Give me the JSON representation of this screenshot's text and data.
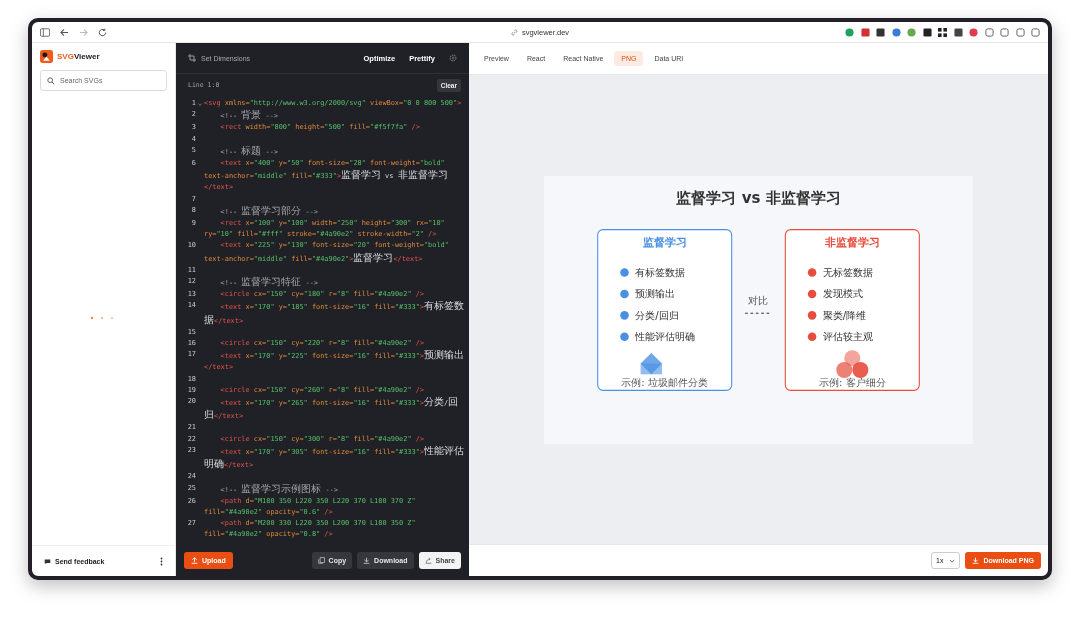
{
  "browser": {
    "url": "svgviewer.dev",
    "forward_disabled": true
  },
  "sidebar": {
    "logo_accent": "SVG",
    "logo_rest": "Viewer",
    "search": {
      "placeholder": "Search SVGs"
    },
    "feedback": "Send feedback"
  },
  "editor": {
    "dimensions": "Set Dimensions",
    "actions": [
      "Optimize",
      "Prettify"
    ],
    "status": "Line 1:0",
    "clear": "Clear",
    "lines": [
      {
        "no": "1",
        "foldable": true,
        "tokens": [
          {
            "kind": "tag",
            "text": "<svg"
          },
          {
            "kind": "attr",
            "text": " xmlns="
          },
          {
            "kind": "val",
            "text": "\"http://www.w3.org/2000/svg\""
          },
          {
            "kind": "attr",
            "text": " viewBox="
          },
          {
            "kind": "val",
            "text": "\"0 0 800 500\""
          },
          {
            "kind": "tag",
            "text": ">"
          }
        ]
      },
      {
        "no": "2",
        "foldable": false,
        "tokens": [
          {
            "kind": "comment",
            "text": "    <!-- 背景 -->"
          }
        ]
      },
      {
        "no": "3",
        "foldable": false,
        "tokens": [
          {
            "kind": "tag",
            "text": "    <rect"
          },
          {
            "kind": "attr",
            "text": " width="
          },
          {
            "kind": "val",
            "text": "\"800\""
          },
          {
            "kind": "attr",
            "text": " height="
          },
          {
            "kind": "val",
            "text": "\"500\""
          },
          {
            "kind": "attr",
            "text": " fill="
          },
          {
            "kind": "val",
            "text": "\"#f5f7fa\""
          },
          {
            "kind": "tag",
            "text": " />"
          }
        ]
      },
      {
        "no": "4",
        "foldable": false
      },
      {
        "no": "5",
        "foldable": false,
        "tokens": [
          {
            "kind": "comment",
            "text": "    <!-- 标题 -->"
          }
        ]
      },
      {
        "no": "6",
        "foldable": false,
        "tokens": [
          {
            "kind": "tag",
            "text": "    <text"
          },
          {
            "kind": "attr",
            "text": " x="
          },
          {
            "kind": "val",
            "text": "\"400\""
          },
          {
            "kind": "attr",
            "text": " y="
          },
          {
            "kind": "val",
            "text": "\"50\""
          },
          {
            "kind": "attr",
            "text": " font-size="
          },
          {
            "kind": "val",
            "text": "\"28\""
          },
          {
            "kind": "attr",
            "text": " font-weight="
          },
          {
            "kind": "val",
            "text": "\"bold\""
          },
          {
            "kind": "attr",
            "text": " text-anchor="
          },
          {
            "kind": "val",
            "text": "\"middle\""
          },
          {
            "kind": "attr",
            "text": " fill="
          },
          {
            "kind": "val",
            "text": "\"#333\""
          },
          {
            "kind": "tag",
            "text": ">"
          },
          {
            "kind": "text",
            "text": "监督学习 vs 非监督学习"
          },
          {
            "kind": "tag",
            "text": "</text>"
          }
        ]
      },
      {
        "no": "7",
        "foldable": false
      },
      {
        "no": "8",
        "foldable": false,
        "tokens": [
          {
            "kind": "comment",
            "text": "    <!-- 监督学习部分 -->"
          }
        ]
      },
      {
        "no": "9",
        "foldable": false,
        "tokens": [
          {
            "kind": "tag",
            "text": "    <rect"
          },
          {
            "kind": "attr",
            "text": " x="
          },
          {
            "kind": "val",
            "text": "\"100\""
          },
          {
            "kind": "attr",
            "text": " y="
          },
          {
            "kind": "val",
            "text": "\"100\""
          },
          {
            "kind": "attr",
            "text": " width="
          },
          {
            "kind": "val",
            "text": "\"250\""
          },
          {
            "kind": "attr",
            "text": " height="
          },
          {
            "kind": "val",
            "text": "\"300\""
          },
          {
            "kind": "attr",
            "text": " rx="
          },
          {
            "kind": "val",
            "text": "\"10\""
          },
          {
            "kind": "attr",
            "text": " ry="
          },
          {
            "kind": "val",
            "text": "\"10\""
          },
          {
            "kind": "attr",
            "text": " fill="
          },
          {
            "kind": "val",
            "text": "\"#fff\""
          },
          {
            "kind": "attr",
            "text": " stroke="
          },
          {
            "kind": "val",
            "text": "\"#4a90e2\""
          },
          {
            "kind": "attr",
            "text": " stroke-width="
          },
          {
            "kind": "val",
            "text": "\"2\""
          },
          {
            "kind": "tag",
            "text": " />"
          }
        ]
      },
      {
        "no": "10",
        "foldable": false,
        "tokens": [
          {
            "kind": "tag",
            "text": "    <text"
          },
          {
            "kind": "attr",
            "text": " x="
          },
          {
            "kind": "val",
            "text": "\"225\""
          },
          {
            "kind": "attr",
            "text": " y="
          },
          {
            "kind": "val",
            "text": "\"130\""
          },
          {
            "kind": "attr",
            "text": " font-size="
          },
          {
            "kind": "val",
            "text": "\"20\""
          },
          {
            "kind": "attr",
            "text": " font-weight="
          },
          {
            "kind": "val",
            "text": "\"bold\""
          },
          {
            "kind": "attr",
            "text": " text-anchor="
          },
          {
            "kind": "val",
            "text": "\"middle\""
          },
          {
            "kind": "attr",
            "text": " fill="
          },
          {
            "kind": "val",
            "text": "\"#4a90e2\""
          },
          {
            "kind": "tag",
            "text": ">"
          },
          {
            "kind": "text",
            "text": "监督学习"
          },
          {
            "kind": "tag",
            "text": "</text>"
          }
        ]
      },
      {
        "no": "11",
        "foldable": false
      },
      {
        "no": "12",
        "foldable": false,
        "tokens": [
          {
            "kind": "comment",
            "text": "    <!-- 监督学习特征 -->"
          }
        ]
      },
      {
        "no": "13",
        "foldable": false,
        "tokens": [
          {
            "kind": "tag",
            "text": "    <circle"
          },
          {
            "kind": "attr",
            "text": " cx="
          },
          {
            "kind": "val",
            "text": "\"150\""
          },
          {
            "kind": "attr",
            "text": " cy="
          },
          {
            "kind": "val",
            "text": "\"180\""
          },
          {
            "kind": "attr",
            "text": " r="
          },
          {
            "kind": "val",
            "text": "\"8\""
          },
          {
            "kind": "attr",
            "text": " fill="
          },
          {
            "kind": "val",
            "text": "\"#4a90e2\""
          },
          {
            "kind": "tag",
            "text": " />"
          }
        ]
      },
      {
        "no": "14",
        "foldable": false,
        "tokens": [
          {
            "kind": "tag",
            "text": "    <text"
          },
          {
            "kind": "attr",
            "text": " x="
          },
          {
            "kind": "val",
            "text": "\"170\""
          },
          {
            "kind": "attr",
            "text": " y="
          },
          {
            "kind": "val",
            "text": "\"185\""
          },
          {
            "kind": "attr",
            "text": " font-size="
          },
          {
            "kind": "val",
            "text": "\"16\""
          },
          {
            "kind": "attr",
            "text": " fill="
          },
          {
            "kind": "val",
            "text": "\"#333\""
          },
          {
            "kind": "tag",
            "text": ">"
          },
          {
            "kind": "text",
            "text": "有标签数据"
          },
          {
            "kind": "tag",
            "text": "</text>"
          }
        ]
      },
      {
        "no": "15",
        "foldable": false
      },
      {
        "no": "16",
        "foldable": false,
        "tokens": [
          {
            "kind": "tag",
            "text": "    <circle"
          },
          {
            "kind": "attr",
            "text": " cx="
          },
          {
            "kind": "val",
            "text": "\"150\""
          },
          {
            "kind": "attr",
            "text": " cy="
          },
          {
            "kind": "val",
            "text": "\"220\""
          },
          {
            "kind": "attr",
            "text": " r="
          },
          {
            "kind": "val",
            "text": "\"8\""
          },
          {
            "kind": "attr",
            "text": " fill="
          },
          {
            "kind": "val",
            "text": "\"#4a90e2\""
          },
          {
            "kind": "tag",
            "text": " />"
          }
        ]
      },
      {
        "no": "17",
        "foldable": false,
        "tokens": [
          {
            "kind": "tag",
            "text": "    <text"
          },
          {
            "kind": "attr",
            "text": " x="
          },
          {
            "kind": "val",
            "text": "\"170\""
          },
          {
            "kind": "attr",
            "text": " y="
          },
          {
            "kind": "val",
            "text": "\"225\""
          },
          {
            "kind": "attr",
            "text": " font-size="
          },
          {
            "kind": "val",
            "text": "\"16\""
          },
          {
            "kind": "attr",
            "text": " fill="
          },
          {
            "kind": "val",
            "text": "\"#333\""
          },
          {
            "kind": "tag",
            "text": ">"
          },
          {
            "kind": "text",
            "text": "预测输出"
          },
          {
            "kind": "tag",
            "text": "</text>"
          }
        ]
      },
      {
        "no": "18",
        "foldable": false
      },
      {
        "no": "19",
        "foldable": false,
        "tokens": [
          {
            "kind": "tag",
            "text": "    <circle"
          },
          {
            "kind": "attr",
            "text": " cx="
          },
          {
            "kind": "val",
            "text": "\"150\""
          },
          {
            "kind": "attr",
            "text": " cy="
          },
          {
            "kind": "val",
            "text": "\"260\""
          },
          {
            "kind": "attr",
            "text": " r="
          },
          {
            "kind": "val",
            "text": "\"8\""
          },
          {
            "kind": "attr",
            "text": " fill="
          },
          {
            "kind": "val",
            "text": "\"#4a90e2\""
          },
          {
            "kind": "tag",
            "text": " />"
          }
        ]
      },
      {
        "no": "20",
        "foldable": false,
        "tokens": [
          {
            "kind": "tag",
            "text": "    <text"
          },
          {
            "kind": "attr",
            "text": " x="
          },
          {
            "kind": "val",
            "text": "\"170\""
          },
          {
            "kind": "attr",
            "text": " y="
          },
          {
            "kind": "val",
            "text": "\"265\""
          },
          {
            "kind": "attr",
            "text": " font-size="
          },
          {
            "kind": "val",
            "text": "\"16\""
          },
          {
            "kind": "attr",
            "text": " fill="
          },
          {
            "kind": "val",
            "text": "\"#333\""
          },
          {
            "kind": "tag",
            "text": ">"
          },
          {
            "kind": "text",
            "text": "分类/回归"
          },
          {
            "kind": "tag",
            "text": "</text>"
          }
        ]
      },
      {
        "no": "21",
        "foldable": false
      },
      {
        "no": "22",
        "foldable": false,
        "tokens": [
          {
            "kind": "tag",
            "text": "    <circle"
          },
          {
            "kind": "attr",
            "text": " cx="
          },
          {
            "kind": "val",
            "text": "\"150\""
          },
          {
            "kind": "attr",
            "text": " cy="
          },
          {
            "kind": "val",
            "text": "\"300\""
          },
          {
            "kind": "attr",
            "text": " r="
          },
          {
            "kind": "val",
            "text": "\"8\""
          },
          {
            "kind": "attr",
            "text": " fill="
          },
          {
            "kind": "val",
            "text": "\"#4a90e2\""
          },
          {
            "kind": "tag",
            "text": " />"
          }
        ]
      },
      {
        "no": "23",
        "foldable": false,
        "tokens": [
          {
            "kind": "tag",
            "text": "    <text"
          },
          {
            "kind": "attr",
            "text": " x="
          },
          {
            "kind": "val",
            "text": "\"170\""
          },
          {
            "kind": "attr",
            "text": " y="
          },
          {
            "kind": "val",
            "text": "\"305\""
          },
          {
            "kind": "attr",
            "text": " font-size="
          },
          {
            "kind": "val",
            "text": "\"16\""
          },
          {
            "kind": "attr",
            "text": " fill="
          },
          {
            "kind": "val",
            "text": "\"#333\""
          },
          {
            "kind": "tag",
            "text": ">"
          },
          {
            "kind": "text",
            "text": "性能评估明确"
          },
          {
            "kind": "tag",
            "text": "</text>"
          }
        ]
      },
      {
        "no": "24",
        "foldable": false
      },
      {
        "no": "25",
        "foldable": false,
        "tokens": [
          {
            "kind": "comment",
            "text": "    <!-- 监督学习示例图标 -->"
          }
        ]
      },
      {
        "no": "26",
        "foldable": false,
        "tokens": [
          {
            "kind": "tag",
            "text": "    <path"
          },
          {
            "kind": "attr",
            "text": " d="
          },
          {
            "kind": "val",
            "text": "\"M180 350 L220 350 L220 370 L180 370 Z\""
          },
          {
            "kind": "attr",
            "text": " fill="
          },
          {
            "kind": "val",
            "text": "\"#4a90e2\""
          },
          {
            "kind": "attr",
            "text": " opacity="
          },
          {
            "kind": "val",
            "text": "\"0.6\""
          },
          {
            "kind": "tag",
            "text": " />"
          }
        ]
      },
      {
        "no": "27",
        "foldable": false,
        "tokens": [
          {
            "kind": "tag",
            "text": "    <path"
          },
          {
            "kind": "attr",
            "text": " d="
          },
          {
            "kind": "val",
            "text": "\"M200 330 L220 350 L200 370 L180 350 Z\""
          },
          {
            "kind": "attr",
            "text": " fill="
          },
          {
            "kind": "val",
            "text": "\"#4a90e2\""
          },
          {
            "kind": "attr",
            "text": " opacity="
          },
          {
            "kind": "val",
            "text": "\"0.8\""
          },
          {
            "kind": "tag",
            "text": " />"
          }
        ]
      }
    ],
    "upload": "Upload",
    "buttons": [
      {
        "label": "Copy",
        "kind": "copy"
      },
      {
        "label": "Download",
        "kind": "download"
      },
      {
        "label": "Share",
        "kind": "share"
      }
    ]
  },
  "tabs": [
    {
      "label": "Preview",
      "selected": false
    },
    {
      "label": "React",
      "selected": false
    },
    {
      "label": "React Native",
      "selected": false
    },
    {
      "label": "PNG",
      "selected": true
    },
    {
      "label": "Data URI",
      "selected": false
    }
  ],
  "preview": {
    "title": "监督学习 vs 非监督学习",
    "compare_label": "对比",
    "cards": [
      {
        "title": "监督学习",
        "color": "#4a90e2",
        "kind": "envelope",
        "items": [
          "有标签数据",
          "预测输出",
          "分类/回归",
          "性能评估明确"
        ],
        "example": "示例: 垃圾邮件分类"
      },
      {
        "title": "非监督学习",
        "color": "#e74c3c",
        "kind": "clusters",
        "items": [
          "无标签数据",
          "发现模式",
          "聚类/降维",
          "评估较主观"
        ],
        "example": "示例: 客户细分"
      }
    ]
  },
  "export": {
    "scale": "1x",
    "download": "Download PNG"
  }
}
